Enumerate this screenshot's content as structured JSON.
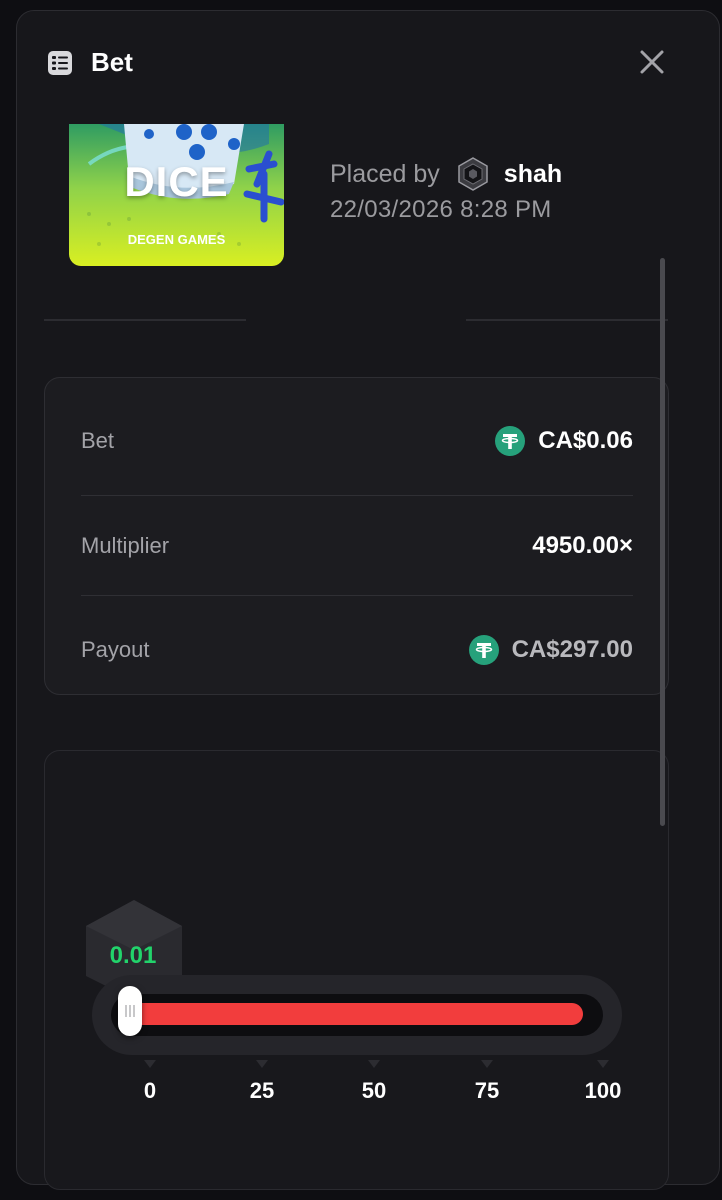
{
  "header": {
    "title": "Bet",
    "icon": "ticket-icon",
    "close_icon": "close-icon"
  },
  "game": {
    "thumbnail_title": "DICE",
    "thumbnail_subtitle": "DEGEN GAMES",
    "placed_by_label": "Placed by",
    "user": "shah",
    "date": "22/03/2026 8:28 PM"
  },
  "details": {
    "bet_label": "Bet",
    "bet_value": "CA$0.06",
    "multiplier_label": "Multiplier",
    "multiplier_value": "4950.00×",
    "payout_label": "Payout",
    "payout_value": "CA$297.00",
    "currency_icon": "tether-icon"
  },
  "dice": {
    "result": "0.01",
    "slider_value": 0.01,
    "ticks": [
      "0",
      "25",
      "50",
      "75",
      "100"
    ]
  },
  "colors": {
    "win": "#22d36b",
    "lose_range": "#f23d3d",
    "tether": "#26a17b",
    "thumbnail_bg": "#c6e72f"
  }
}
